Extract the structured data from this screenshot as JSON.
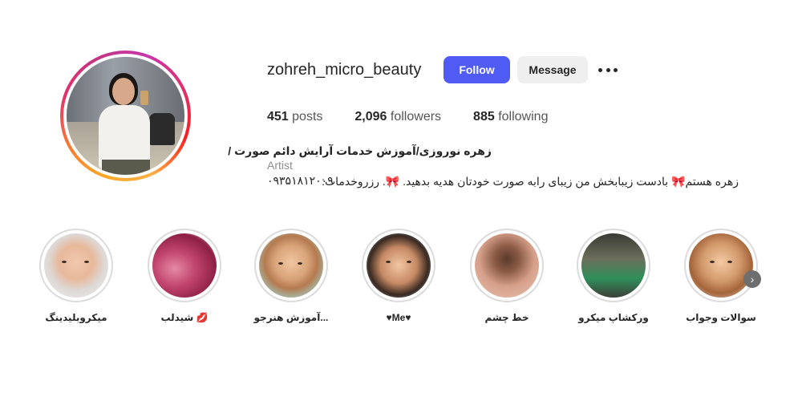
{
  "profile": {
    "username": "zohreh_micro_beauty",
    "follow_label": "Follow",
    "message_label": "Message",
    "more_icon": "more-horizontal-icon",
    "stats": [
      {
        "value": "451",
        "label": "posts"
      },
      {
        "value": "2,096",
        "label": "followers"
      },
      {
        "value": "885",
        "label": "following"
      }
    ],
    "bio_title": "زهره نوروزی/آموزش خدمات آرایش دائم صورت /",
    "bio_category": "Artist",
    "bio_line1": "زهره هستم🎀 بادست زیبابخش من زیبای رابه صورت خودتان هدیه بدهید. 🎀. رزروخدمات:",
    "bio_phone": "۰۹۳۵۱۸۱۲۰۰۹"
  },
  "highlights": [
    {
      "label": "میکروبلیدینگ"
    },
    {
      "label": "شیدلب 💋"
    },
    {
      "label": "آموزش هنرجو..."
    },
    {
      "label": "♥Me♥"
    },
    {
      "label": "خط چشم"
    },
    {
      "label": "ورکشاپ میکرو"
    },
    {
      "label": "سوالات وجواب"
    }
  ],
  "colors": {
    "follow_button": "#4f5bf2",
    "message_button": "#efefef",
    "story_ring": "#e1306c"
  }
}
